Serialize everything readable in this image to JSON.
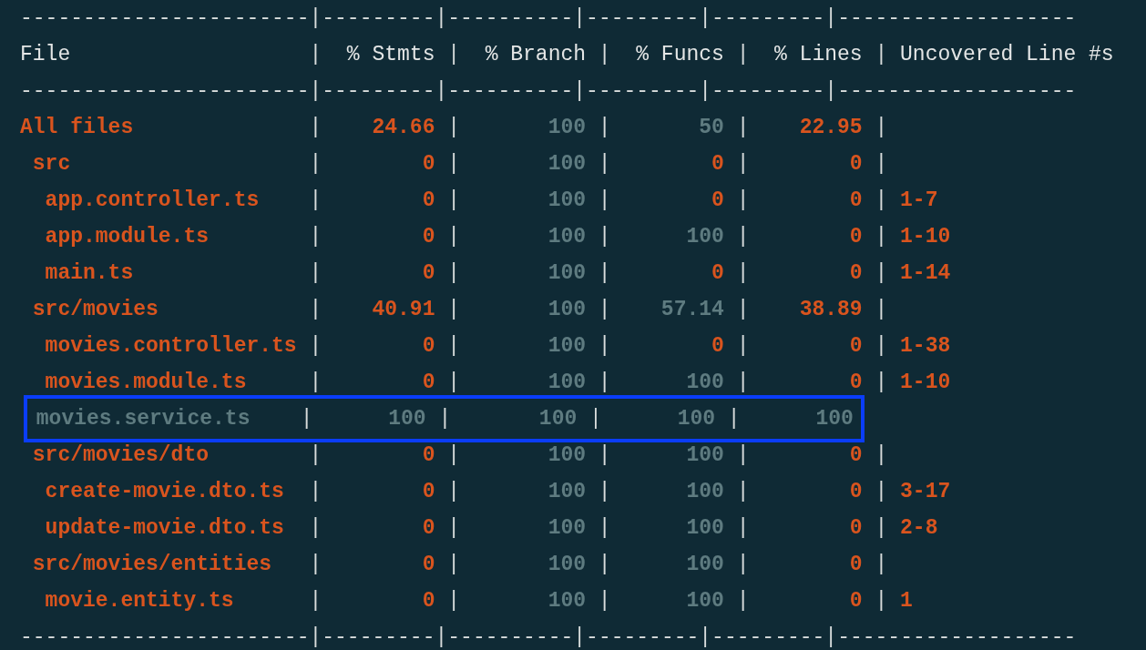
{
  "separator": "|",
  "rules": [
    "-----------------------|---------|----------|---------|---------|-------------------",
    "-----------------------|---------|----------|---------|---------|-------------------",
    "-----------------------|---------|----------|---------|---------|-------------------"
  ],
  "header": [
    "File",
    "% Stmts",
    "% Branch",
    "% Funcs",
    "% Lines",
    "Uncovered Line #s"
  ],
  "rows": [
    {
      "file": "All files",
      "color": "#d9541e",
      "highlighted": false,
      "values": [
        {
          "text": "24.66",
          "color": "#d9541e"
        },
        {
          "text": "100",
          "color": "#5e7b80"
        },
        {
          "text": "50",
          "color": "#5e7b80"
        },
        {
          "text": "22.95",
          "color": "#d9541e"
        }
      ],
      "children": [
        {
          "file": "src",
          "color": "#d9541e",
          "highlighted": false,
          "values": [
            {
              "text": "0",
              "color": "#d9541e"
            },
            {
              "text": "100",
              "color": "#5e7b80"
            },
            {
              "text": "0",
              "color": "#d9541e"
            },
            {
              "text": "0",
              "color": "#d9541e"
            }
          ],
          "children": [
            {
              "file": "app.controller.ts",
              "color": "#d9541e",
              "highlighted": false,
              "uncovered": "1-7",
              "values": [
                {
                  "text": "0",
                  "color": "#d9541e"
                },
                {
                  "text": "100",
                  "color": "#5e7b80"
                },
                {
                  "text": "0",
                  "color": "#d9541e"
                },
                {
                  "text": "0",
                  "color": "#d9541e"
                }
              ]
            },
            {
              "file": "app.module.ts",
              "color": "#d9541e",
              "highlighted": false,
              "uncovered": "1-10",
              "values": [
                {
                  "text": "0",
                  "color": "#d9541e"
                },
                {
                  "text": "100",
                  "color": "#5e7b80"
                },
                {
                  "text": "100",
                  "color": "#5e7b80"
                },
                {
                  "text": "0",
                  "color": "#d9541e"
                }
              ]
            },
            {
              "file": "main.ts",
              "color": "#d9541e",
              "highlighted": false,
              "uncovered": "1-14",
              "values": [
                {
                  "text": "0",
                  "color": "#d9541e"
                },
                {
                  "text": "100",
                  "color": "#5e7b80"
                },
                {
                  "text": "0",
                  "color": "#d9541e"
                },
                {
                  "text": "0",
                  "color": "#d9541e"
                }
              ]
            }
          ]
        },
        {
          "file": "src/movies",
          "color": "#d9541e",
          "highlighted": false,
          "values": [
            {
              "text": "40.91",
              "color": "#d9541e"
            },
            {
              "text": "100",
              "color": "#5e7b80"
            },
            {
              "text": "57.14",
              "color": "#5e7b80"
            },
            {
              "text": "38.89",
              "color": "#d9541e"
            }
          ],
          "children": [
            {
              "file": "movies.controller.ts",
              "color": "#d9541e",
              "highlighted": false,
              "uncovered": "1-38",
              "values": [
                {
                  "text": "0",
                  "color": "#d9541e"
                },
                {
                  "text": "100",
                  "color": "#5e7b80"
                },
                {
                  "text": "0",
                  "color": "#d9541e"
                },
                {
                  "text": "0",
                  "color": "#d9541e"
                }
              ]
            },
            {
              "file": "movies.module.ts",
              "color": "#d9541e",
              "highlighted": false,
              "uncovered": "1-10",
              "values": [
                {
                  "text": "0",
                  "color": "#d9541e"
                },
                {
                  "text": "100",
                  "color": "#5e7b80"
                },
                {
                  "text": "100",
                  "color": "#5e7b80"
                },
                {
                  "text": "0",
                  "color": "#d9541e"
                }
              ]
            },
            {
              "file": "movies.service.ts",
              "color": "#5e7b80",
              "highlighted": true,
              "values": [
                {
                  "text": "100",
                  "color": "#5e7b80"
                },
                {
                  "text": "100",
                  "color": "#5e7b80"
                },
                {
                  "text": "100",
                  "color": "#5e7b80"
                },
                {
                  "text": "100",
                  "color": "#5e7b80"
                }
              ]
            }
          ]
        },
        {
          "file": "src/movies/dto",
          "color": "#d9541e",
          "highlighted": false,
          "values": [
            {
              "text": "0",
              "color": "#d9541e"
            },
            {
              "text": "100",
              "color": "#5e7b80"
            },
            {
              "text": "100",
              "color": "#5e7b80"
            },
            {
              "text": "0",
              "color": "#d9541e"
            }
          ],
          "children": [
            {
              "file": "create-movie.dto.ts",
              "color": "#d9541e",
              "highlighted": false,
              "uncovered": "3-17",
              "values": [
                {
                  "text": "0",
                  "color": "#d9541e"
                },
                {
                  "text": "100",
                  "color": "#5e7b80"
                },
                {
                  "text": "100",
                  "color": "#5e7b80"
                },
                {
                  "text": "0",
                  "color": "#d9541e"
                }
              ]
            },
            {
              "file": "update-movie.dto.ts",
              "color": "#d9541e",
              "highlighted": false,
              "uncovered": "2-8",
              "values": [
                {
                  "text": "0",
                  "color": "#d9541e"
                },
                {
                  "text": "100",
                  "color": "#5e7b80"
                },
                {
                  "text": "100",
                  "color": "#5e7b80"
                },
                {
                  "text": "0",
                  "color": "#d9541e"
                }
              ]
            }
          ]
        },
        {
          "file": "src/movies/entities",
          "color": "#d9541e",
          "highlighted": false,
          "values": [
            {
              "text": "0",
              "color": "#d9541e"
            },
            {
              "text": "100",
              "color": "#5e7b80"
            },
            {
              "text": "100",
              "color": "#5e7b80"
            },
            {
              "text": "0",
              "color": "#d9541e"
            }
          ],
          "children": [
            {
              "file": "movie.entity.ts",
              "color": "#d9541e",
              "highlighted": false,
              "uncovered": "1",
              "values": [
                {
                  "text": "0",
                  "color": "#d9541e"
                },
                {
                  "text": "100",
                  "color": "#5e7b80"
                },
                {
                  "text": "100",
                  "color": "#5e7b80"
                },
                {
                  "text": "0",
                  "color": "#d9541e"
                }
              ]
            }
          ]
        }
      ]
    }
  ]
}
